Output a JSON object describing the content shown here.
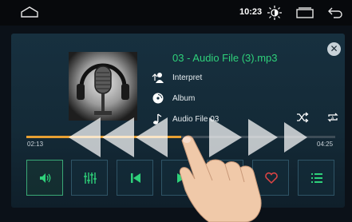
{
  "statusbar": {
    "time": "10:23"
  },
  "track": {
    "title": "03 - Audio File (3).mp3",
    "artist": "Interpret",
    "album": "Album",
    "folder": "Audio File 03"
  },
  "progress": {
    "elapsed": "02:13",
    "total": "04:25",
    "fraction": 0.5
  },
  "colors": {
    "accent": "#2ed17a",
    "progress": "#e8a032",
    "favorite": "#e04545"
  },
  "controls": [
    {
      "name": "sound-button",
      "icon": "speaker-icon"
    },
    {
      "name": "equalizer-button",
      "icon": "equalizer-icon"
    },
    {
      "name": "previous-button",
      "icon": "skip-previous-icon"
    },
    {
      "name": "play-pause-button",
      "icon": "play-icon"
    },
    {
      "name": "next-button",
      "icon": "skip-next-icon"
    },
    {
      "name": "favorite-button",
      "icon": "heart-icon"
    },
    {
      "name": "playlist-button",
      "icon": "list-icon"
    }
  ]
}
